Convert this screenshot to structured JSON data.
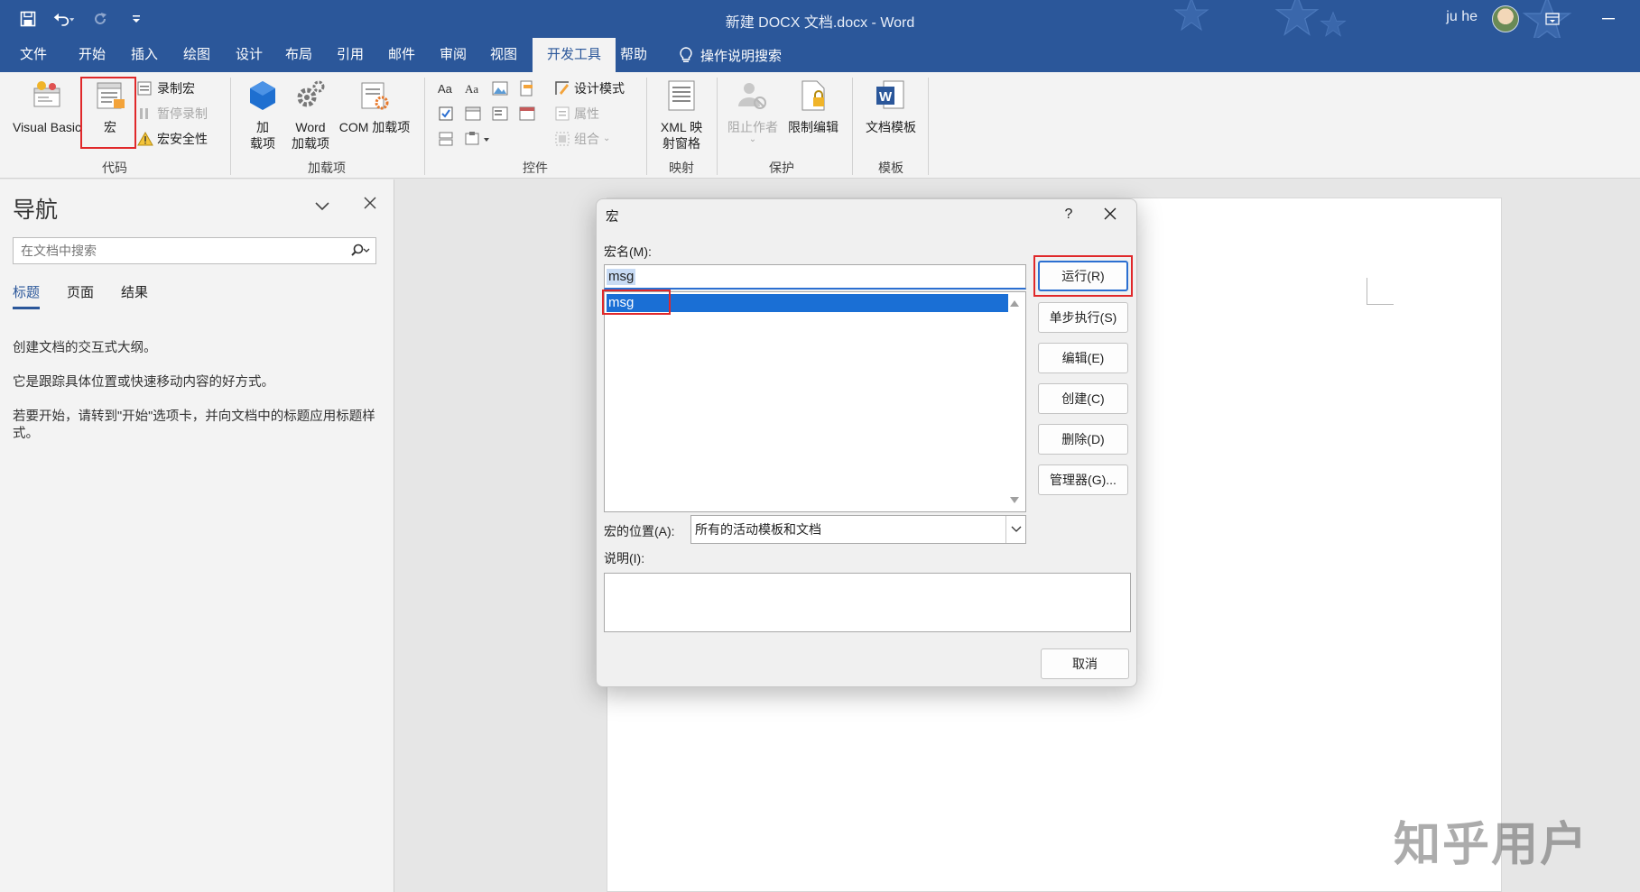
{
  "titlebar": {
    "title": "新建 DOCX 文档.docx  -  Word",
    "user_name": "ju he"
  },
  "ribbon_tabs": [
    "文件",
    "开始",
    "插入",
    "绘图",
    "设计",
    "布局",
    "引用",
    "邮件",
    "审阅",
    "视图",
    "开发工具",
    "帮助"
  ],
  "active_tab": "开发工具",
  "tell_me": "操作说明搜索",
  "ribbon": {
    "code": {
      "label": "代码",
      "visual_basic": "Visual Basic",
      "macros": "宏",
      "record_macro": "录制宏",
      "pause_recording": "暂停录制",
      "macro_security": "宏安全性"
    },
    "addins": {
      "label": "加载项",
      "addins_line1": "加",
      "addins_line2": "载项",
      "word_addins_line1": "Word",
      "word_addins_line2": "加载项",
      "com_addins": "COM 加载项"
    },
    "controls": {
      "label": "控件",
      "design_mode": "设计模式",
      "properties": "属性",
      "group": "组合"
    },
    "mapping": {
      "label": "映射",
      "xml_line1": "XML 映",
      "xml_line2": "射窗格"
    },
    "protect": {
      "label": "保护",
      "block_authors": "阻止作者",
      "restrict_editing": "限制编辑"
    },
    "templates": {
      "label": "模板",
      "document_template": "文档模板"
    }
  },
  "nav": {
    "title": "导航",
    "search_placeholder": "在文档中搜索",
    "tabs": [
      "标题",
      "页面",
      "结果"
    ],
    "active_tab": "标题",
    "line1": "创建文档的交互式大纲。",
    "line2": "它是跟踪具体位置或快速移动内容的好方式。",
    "line3": "若要开始，请转到\"开始\"选项卡，并向文档中的标题应用标题样式。"
  },
  "dialog": {
    "title": "宏",
    "help": "?",
    "macro_name_label": "宏名(M):",
    "macro_name_value": "msg",
    "macros_list": [
      "msg"
    ],
    "selected_macro": "msg",
    "buttons": {
      "run": "运行(R)",
      "step_into": "单步执行(S)",
      "edit": "编辑(E)",
      "create": "创建(C)",
      "delete": "删除(D)",
      "organizer": "管理器(G)..."
    },
    "location_label": "宏的位置(A):",
    "location_value": "所有的活动模板和文档",
    "description_label": "说明(I):",
    "description_value": "",
    "cancel": "取消"
  },
  "watermark": "知乎用户",
  "colors": {
    "brand": "#2b579a",
    "selection": "#1a6fd5",
    "highlight_box": "#e0282a"
  }
}
